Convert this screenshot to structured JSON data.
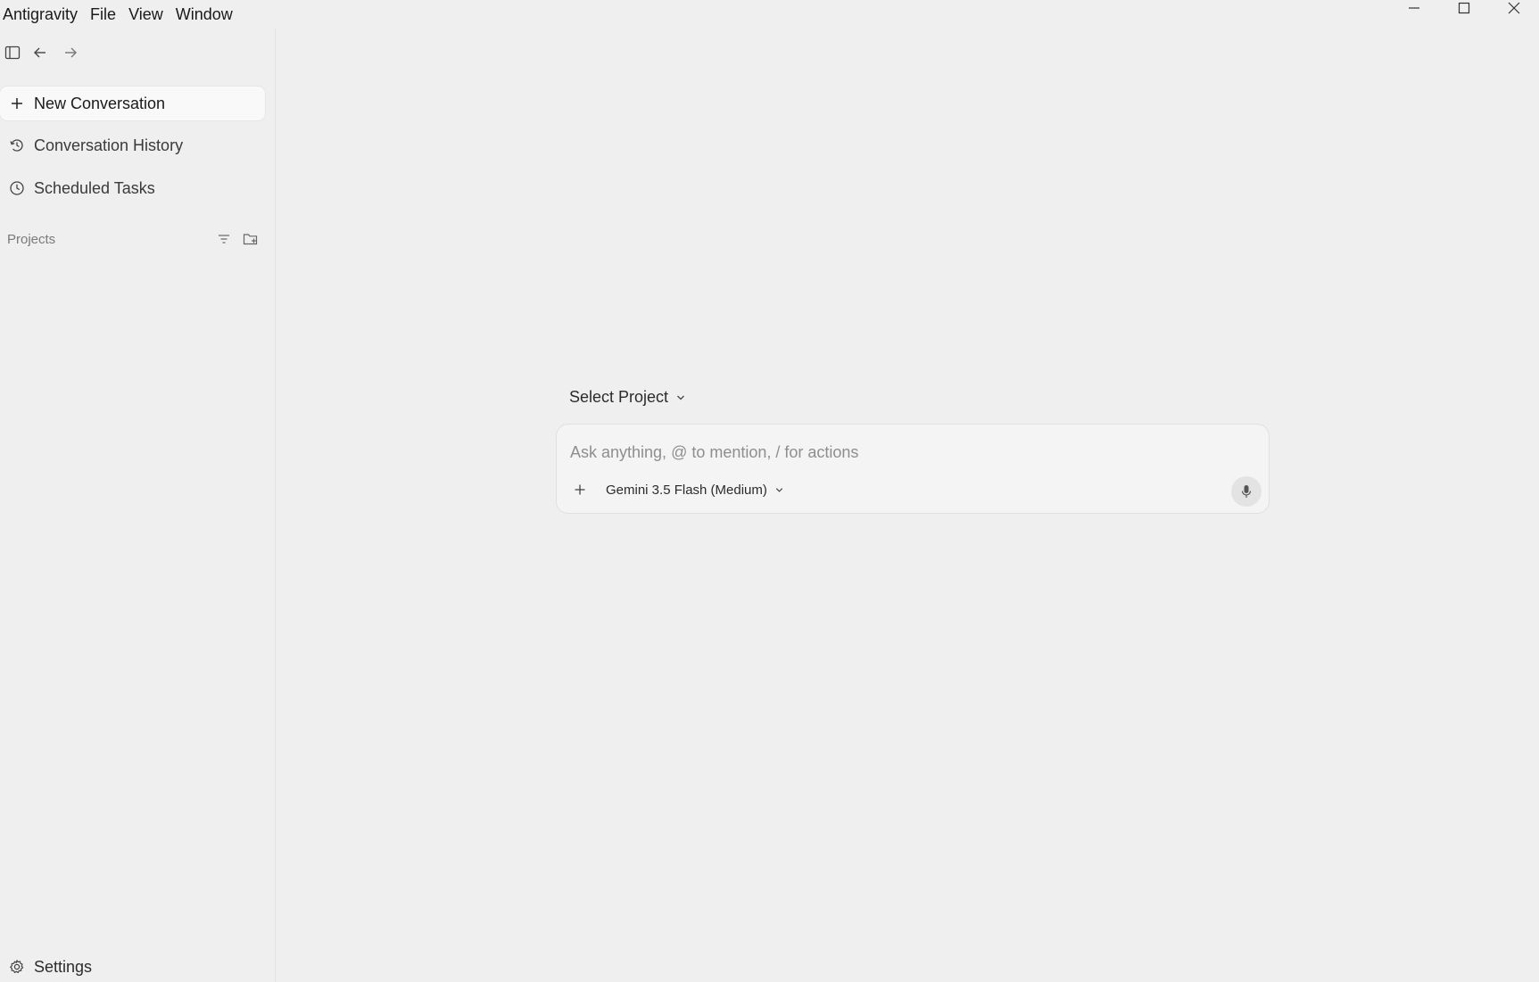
{
  "titlebar": {
    "menu": [
      "Antigravity",
      "File",
      "View",
      "Window"
    ]
  },
  "sidebar": {
    "items": [
      {
        "label": "New Conversation",
        "icon": "plus-icon"
      },
      {
        "label": "Conversation History",
        "icon": "history-icon"
      },
      {
        "label": "Scheduled Tasks",
        "icon": "clock-icon"
      }
    ],
    "projects_label": "Projects",
    "settings_label": "Settings"
  },
  "main": {
    "project_select_label": "Select Project",
    "chat": {
      "placeholder": "Ask anything, @ to mention, / for actions",
      "model_label": "Gemini 3.5 Flash (Medium)"
    }
  },
  "colors": {
    "background": "#efefef",
    "active_item": "#f9f9f9",
    "input_bg": "#f4f4f4"
  }
}
